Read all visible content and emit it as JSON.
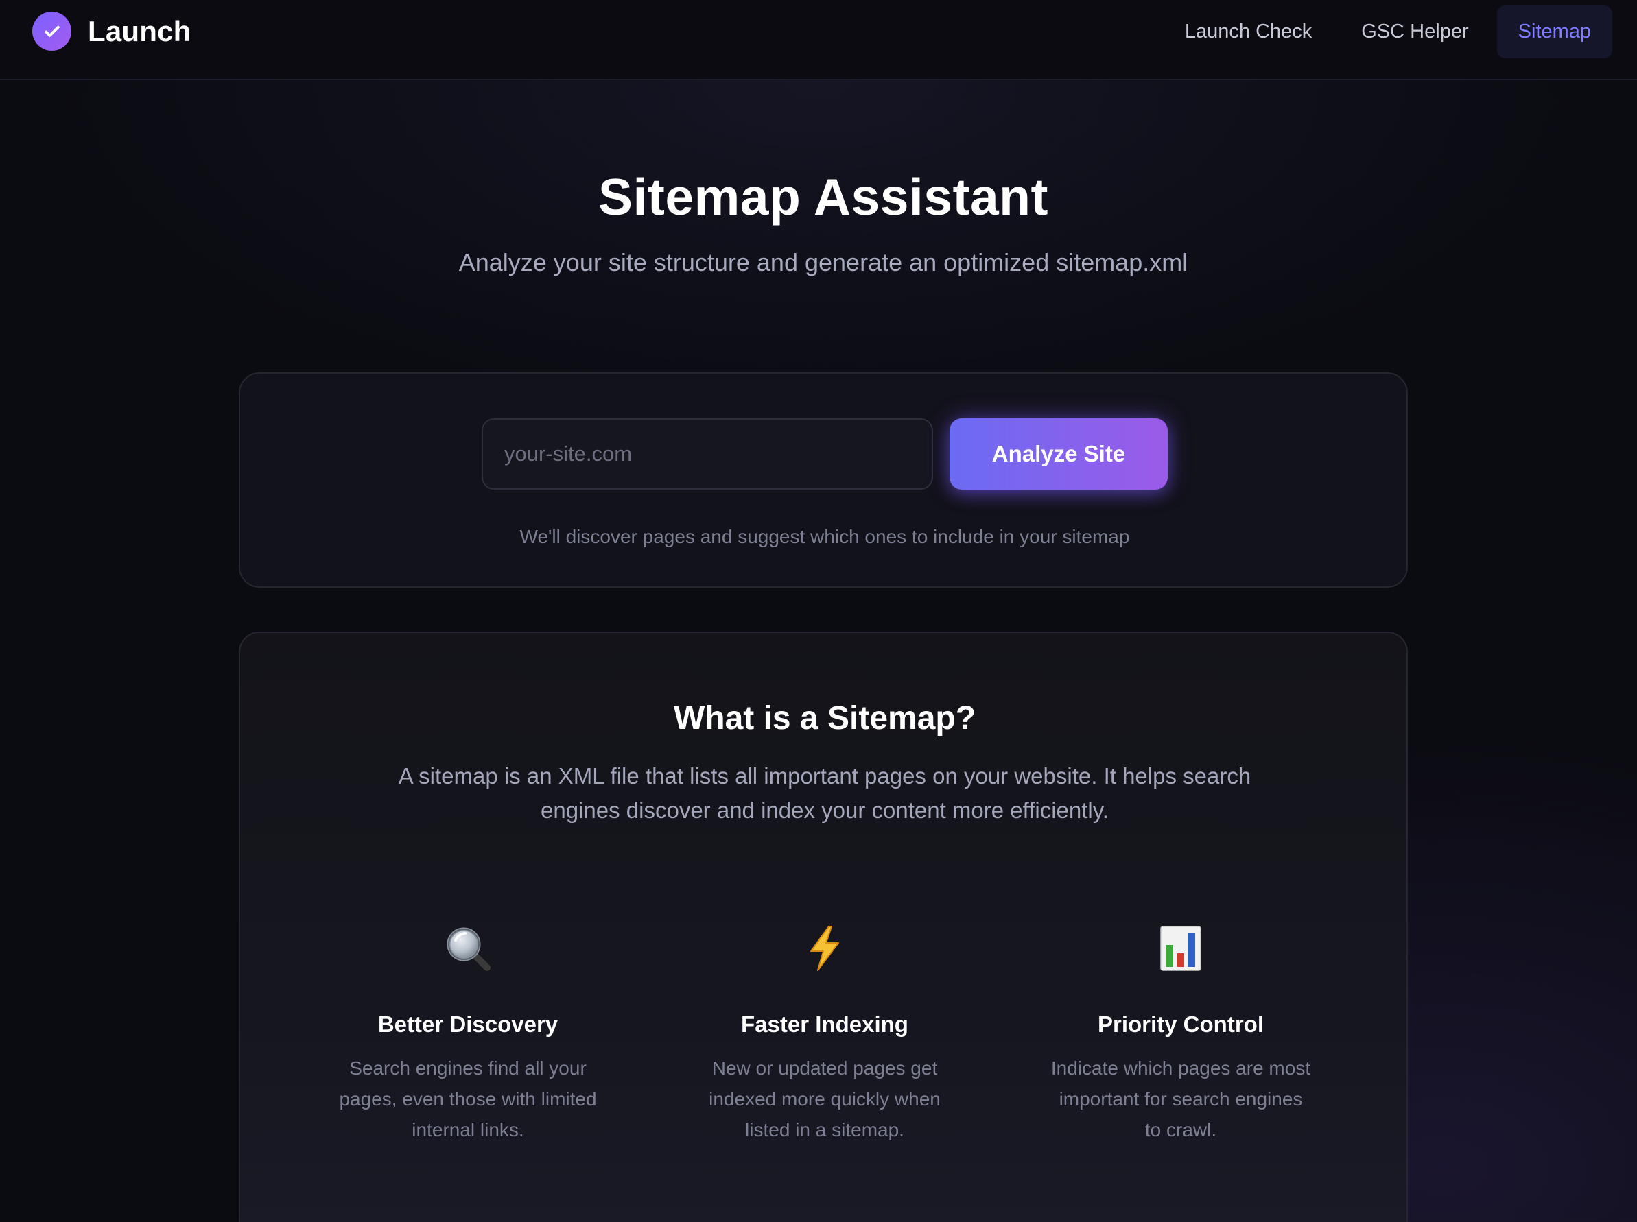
{
  "header": {
    "brand": "Launch",
    "nav": [
      {
        "label": "Launch Check",
        "active": false
      },
      {
        "label": "GSC Helper",
        "active": false
      },
      {
        "label": "Sitemap",
        "active": true
      }
    ]
  },
  "hero": {
    "title": "Sitemap Assistant",
    "subtitle": "Analyze your site structure and generate an optimized sitemap.xml"
  },
  "form": {
    "input_value": "",
    "input_placeholder": "your-site.com",
    "button_label": "Analyze Site",
    "hint": "We'll discover pages and suggest which ones to include in your sitemap"
  },
  "info": {
    "title": "What is a Sitemap?",
    "description": "A sitemap is an XML file that lists all important pages on your website. It helps search engines discover and index your content more efficiently.",
    "features": [
      {
        "icon": "magnifying-glass-icon",
        "title": "Better Discovery",
        "description": "Search engines find all your pages, even those with limited internal links."
      },
      {
        "icon": "lightning-bolt-icon",
        "title": "Faster Indexing",
        "description": "New or updated pages get indexed more quickly when listed in a sitemap."
      },
      {
        "icon": "bar-chart-icon",
        "title": "Priority Control",
        "description": "Indicate which pages are most important for search engines to crawl."
      }
    ]
  },
  "colors": {
    "accent": "#7f7cff",
    "button_gradient_start": "#6b6bf3",
    "button_gradient_end": "#9b5be8",
    "background": "#0b0b12"
  }
}
